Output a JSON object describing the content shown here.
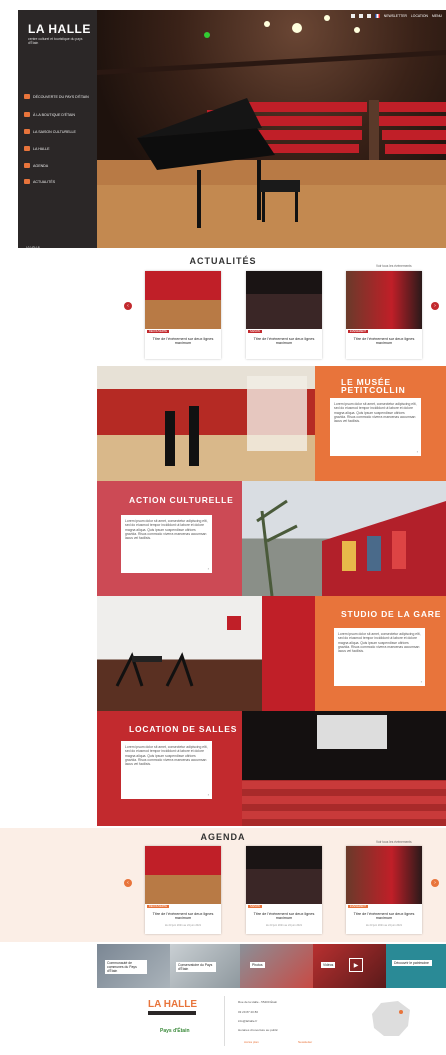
{
  "sidebar": {
    "logo": "LA HALLE",
    "logo_sub": "centre culturel et touristique du pays d'Étain",
    "items": [
      {
        "label": "DÉCOUVERTE DU PAYS D'ÉTAIN",
        "icon": "map-icon"
      },
      {
        "label": "À LA BOUTIQUE D'ÉTAIN",
        "icon": "shop-icon"
      },
      {
        "label": "LA SAISON CULTURELLE",
        "icon": "saison-icon"
      },
      {
        "label": "LA HALLE",
        "icon": "building-icon"
      },
      {
        "label": "AGENDA",
        "icon": "calendar-icon"
      },
      {
        "label": "ACTUALITÉS",
        "icon": "news-icon"
      }
    ],
    "footer": "LA HALLE"
  },
  "topbar": {
    "newsletter": "NEWSLETTER",
    "location": "LOCATION",
    "more": "MENU"
  },
  "actualites": {
    "title": "ACTUALITÉS",
    "see_all": "Voir tous les événements",
    "cards": [
      {
        "badge": "DÉCOUVERTE",
        "text": "Titre de l'événement sur deux lignes maximum",
        "date": ""
      },
      {
        "badge": "SAISON",
        "text": "Titre de l'événement sur deux lignes maximum",
        "date": ""
      },
      {
        "badge": "ÉVÉNEMENT",
        "text": "Titre de l'événement sur deux lignes maximum",
        "date": ""
      }
    ]
  },
  "blocks": [
    {
      "title": "LE MUSÉE PETITCOLLIN",
      "text": "Lorem ipsum dolor sit amet, consectetur adipiscing elit, sed do eiusmod tempor incididunt ut labore et dolore magna aliqua. Quis ipsum suspendisse ultrices gravida. Risus commodo viverra maecenas accumsan lacus vel facilisis."
    },
    {
      "title": "ACTION CULTURELLE",
      "text": "Lorem ipsum dolor sit amet, consectetur adipiscing elit, sed do eiusmod tempor incididunt ut labore et dolore magna aliqua. Quis ipsum suspendisse ultrices gravida. Risus commodo viverra maecenas accumsan lacus vel facilisis."
    },
    {
      "title": "STUDIO DE LA GARE",
      "text": "Lorem ipsum dolor sit amet, consectetur adipiscing elit, sed do eiusmod tempor incididunt ut labore et dolore magna aliqua. Quis ipsum suspendisse ultrices gravida. Risus commodo viverra maecenas accumsan lacus vel facilisis."
    },
    {
      "title": "LOCATION DE SALLES",
      "text": "Lorem ipsum dolor sit amet, consectetur adipiscing elit, sed do eiusmod tempor incididunt ut labore et dolore magna aliqua. Quis ipsum suspendisse ultrices gravida. Risus commodo viverra maecenas accumsan lacus vel facilisis."
    }
  ],
  "agenda": {
    "title": "AGENDA",
    "see_all": "Voir tous les événements",
    "cards": [
      {
        "badge": "DÉCOUVERTE",
        "text": "Titre de l'événement sur deux lignes maximum",
        "date": "du 23 juin 2021 au 24 juin 2021"
      },
      {
        "badge": "SAISON",
        "text": "Titre de l'événement sur deux lignes maximum",
        "date": "du 23 juin 2021 au 24 juin 2021"
      },
      {
        "badge": "ÉVÉNEMENT",
        "text": "Titre de l'événement sur deux lignes maximum",
        "date": "du 23 juin 2021 au 24 juin 2021"
      }
    ]
  },
  "banners": [
    {
      "label": "Communauté de communes du Pays d'Étain"
    },
    {
      "label": "Conservatoire du Pays d'Étain"
    },
    {
      "label": "Photos"
    },
    {
      "label": "Vidéos"
    },
    {
      "label": "Découvrir le patrimoine"
    }
  ],
  "footer": {
    "logo": "LA HALLE",
    "partner": "Pays d'Étain",
    "address": "Rue de la Halle - 55400 Étain",
    "phone": "03 29 87 20 80",
    "email": "info@lahalle.fr",
    "hours": "Horaires d'ouverture au public",
    "link1": "Accès plan",
    "link2": "Newsletter"
  },
  "colors": {
    "orange": "#e8743b",
    "red": "#c22a2e",
    "rose": "#cc4a55",
    "dark": "#2b2727"
  }
}
